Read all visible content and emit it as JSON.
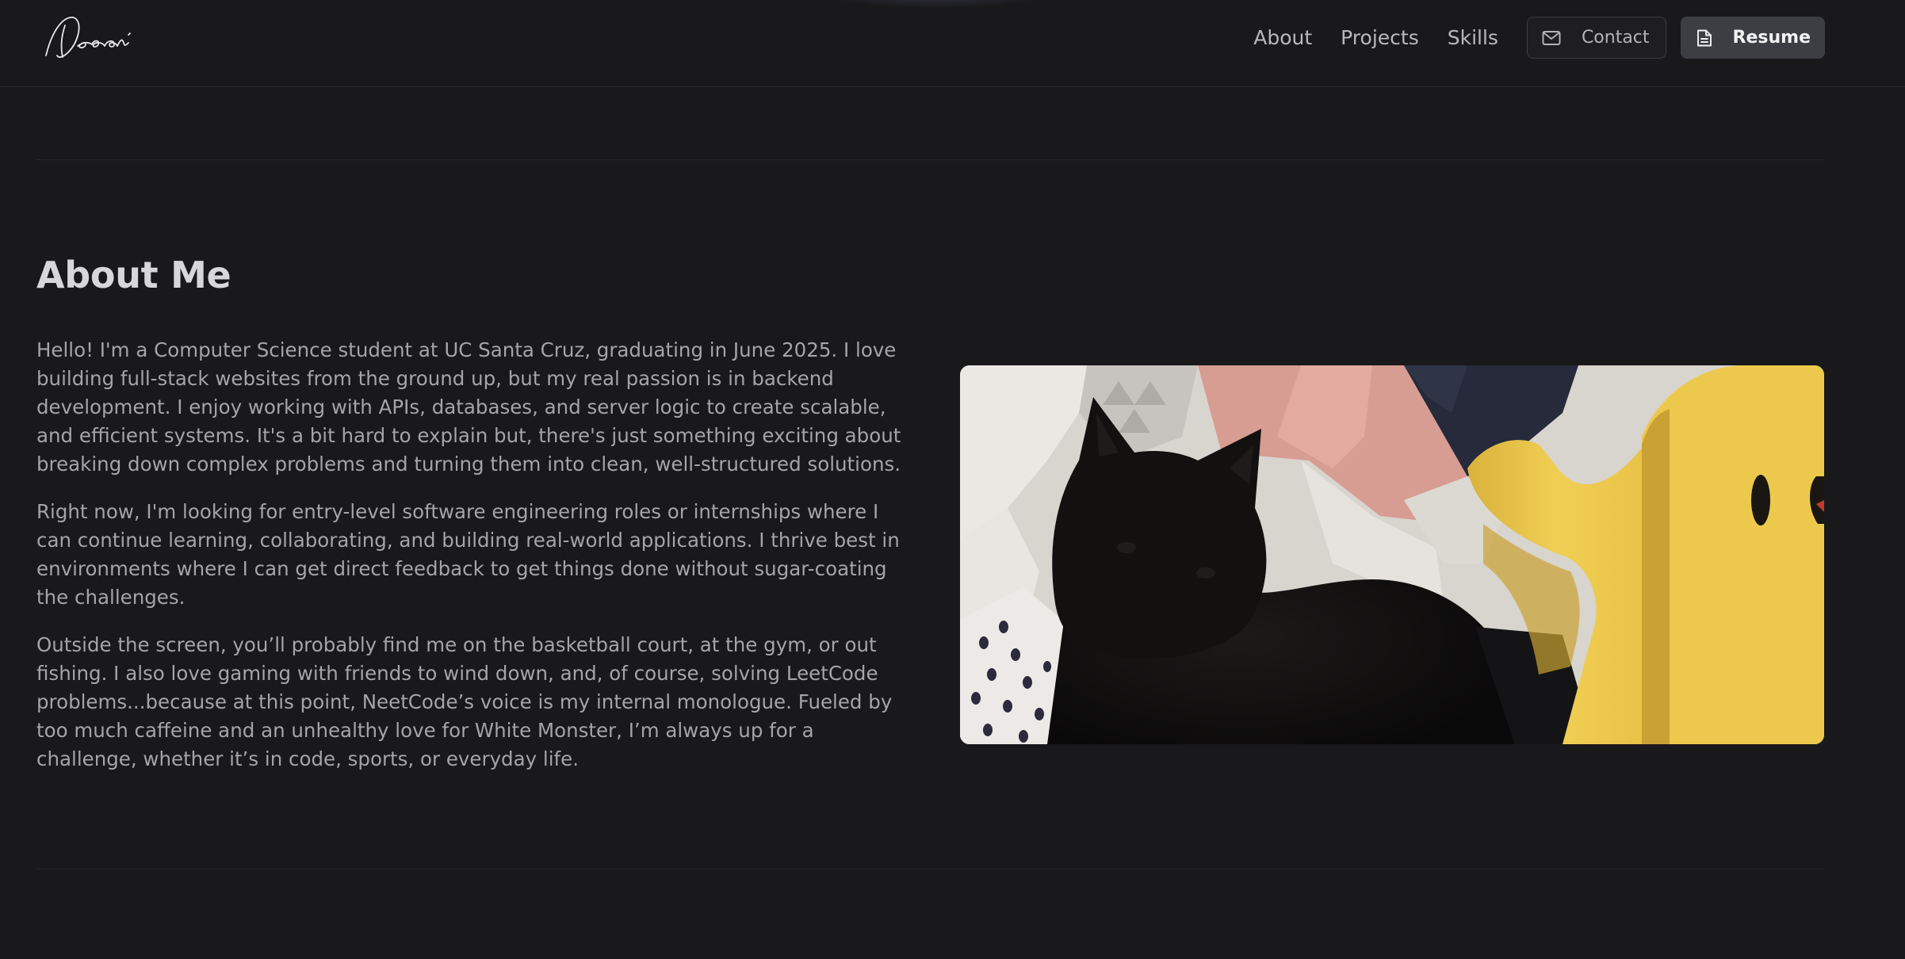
{
  "header": {
    "nav": {
      "about": "About",
      "projects": "Projects",
      "skills": "Skills"
    },
    "buttons": {
      "contact": "Contact",
      "resume": "Resume"
    },
    "icons": {
      "contact": "mail-icon",
      "resume": "document-icon",
      "logo": "signature-logo"
    }
  },
  "about": {
    "title": "About Me",
    "paragraphs": [
      "Hello! I'm a Computer Science student at UC Santa Cruz, graduating in June 2025. I love building full-stack websites from the ground up, but my real passion is in backend development. I enjoy working with APIs, databases, and server logic to create scalable, and efficient systems. It's a bit hard to explain but, there's just something exciting about breaking down complex problems and turning them into clean, well-structured solutions.",
      "Right now, I'm looking for entry-level software engineering roles or internships where I can continue learning, collaborating, and building real-world applications. I thrive best in environments where I can get direct feedback to get things done without sugar-coating the challenges.",
      "Outside the screen, you’ll probably find me on the basketball court, at the gym, or out fishing. I also love gaming with friends to wind down, and, of course, solving LeetCode problems...because at this point, NeetCode’s voice is my internal monologue. Fueled by too much caffeine and an unhealthy love for White Monster, I’m always up for a challenge, whether it’s in code, sports, or everyday life."
    ],
    "photo": "photo of a black cat next to a yellow plush toy"
  },
  "colors": {
    "background": "#19191b",
    "title": "#d7d7da",
    "body_text": "#a4a4a9",
    "resume_button": "#3d3e44"
  }
}
